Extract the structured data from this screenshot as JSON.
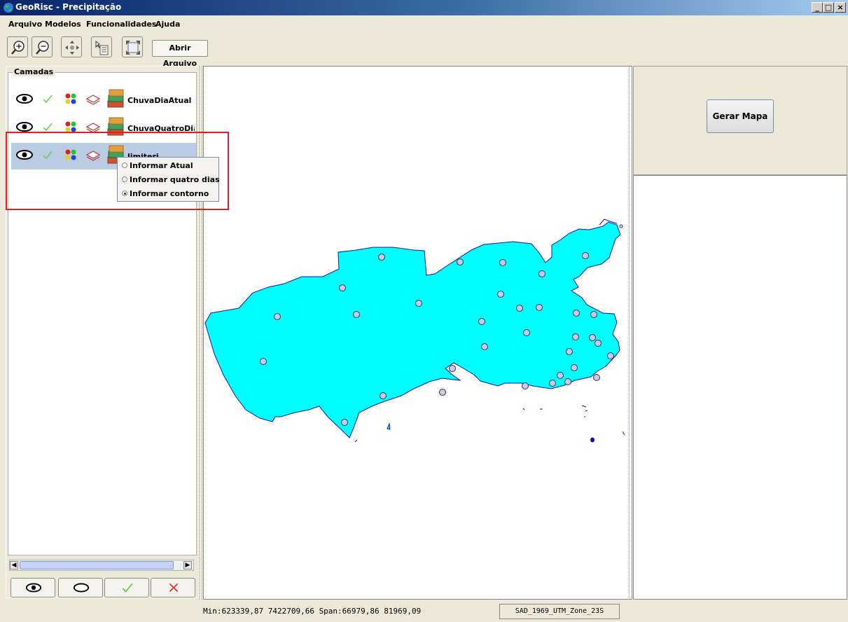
{
  "window": {
    "title": "GeoRisc - Precipitação",
    "minimize": "_",
    "maximize": "□",
    "close": "×"
  },
  "menu": {
    "items": [
      "Arquivo",
      "Modelos",
      "Funcionalidades",
      "Ajuda"
    ]
  },
  "toolbar": {
    "icons": [
      "zoom-in-icon",
      "zoom-out-icon",
      "pan-icon",
      "info-icon",
      "extent-icon"
    ],
    "open_file_label": "Abrir Arquivo"
  },
  "layers": {
    "title": "Camadas",
    "items": [
      {
        "label": "ChuvaDiaAtual",
        "selected": false
      },
      {
        "label": "ChuvaQuatroDias",
        "selected": false
      },
      {
        "label": "limiterj",
        "selected": true
      }
    ]
  },
  "context_menu": {
    "options": [
      {
        "label": "Informar Atual",
        "checked": false
      },
      {
        "label": "Informar quatro dias",
        "checked": false
      },
      {
        "label": "Informar contorno",
        "checked": true
      }
    ]
  },
  "right_panel": {
    "generate_label": "Gerar Mapa"
  },
  "status": {
    "coords": "Min:623339,87 7422709,66 Span:66979,86 81969,09",
    "projection": "SAD_1969_UTM_Zone_23S"
  },
  "colors": {
    "map_fill": "#00ffff",
    "map_stroke": "#1010c0",
    "points": "#c8c8f0",
    "highlight": "#e02020"
  }
}
